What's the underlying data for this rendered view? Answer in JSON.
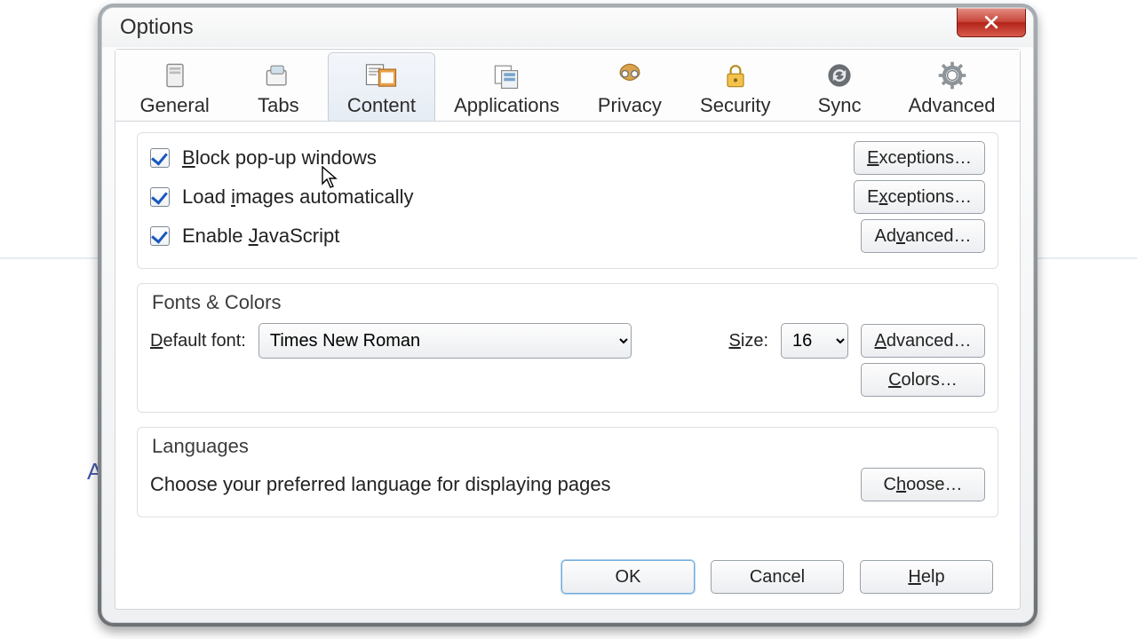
{
  "window": {
    "title": "Options"
  },
  "tabs": [
    {
      "label": "General"
    },
    {
      "label": "Tabs"
    },
    {
      "label": "Content"
    },
    {
      "label": "Applications"
    },
    {
      "label": "Privacy"
    },
    {
      "label": "Security"
    },
    {
      "label": "Sync"
    },
    {
      "label": "Advanced"
    }
  ],
  "active_tab": "Content",
  "content": {
    "block_popups": {
      "checked": true,
      "label_pre": "B",
      "label_rest": "lock pop-up windows",
      "button": "Exceptions…",
      "button_u": "E"
    },
    "load_images": {
      "checked": true,
      "label_pre": "Load ",
      "label_u": "i",
      "label_rest": "mages automatically",
      "button": "Exceptions…",
      "button_u": "x"
    },
    "enable_js": {
      "checked": true,
      "label_pre": "Enable ",
      "label_u": "J",
      "label_rest": "avaScript",
      "button": "Advanced…",
      "button_u": "v"
    }
  },
  "fonts": {
    "section": "Fonts & Colors",
    "default_label_u": "D",
    "default_label_rest": "efault font:",
    "font_value": "Times New Roman",
    "size_label_u": "S",
    "size_label_rest": "ize:",
    "size_value": "16",
    "advanced_u": "A",
    "advanced_rest": "dvanced…",
    "colors_u": "C",
    "colors_rest": "olors…"
  },
  "languages": {
    "section": "Languages",
    "desc": "Choose your preferred language for displaying pages",
    "choose_u": "h",
    "choose_pre": "C",
    "choose_rest": "oose…"
  },
  "footer": {
    "ok": "OK",
    "cancel": "Cancel",
    "help_u": "H",
    "help_rest": "elp"
  }
}
